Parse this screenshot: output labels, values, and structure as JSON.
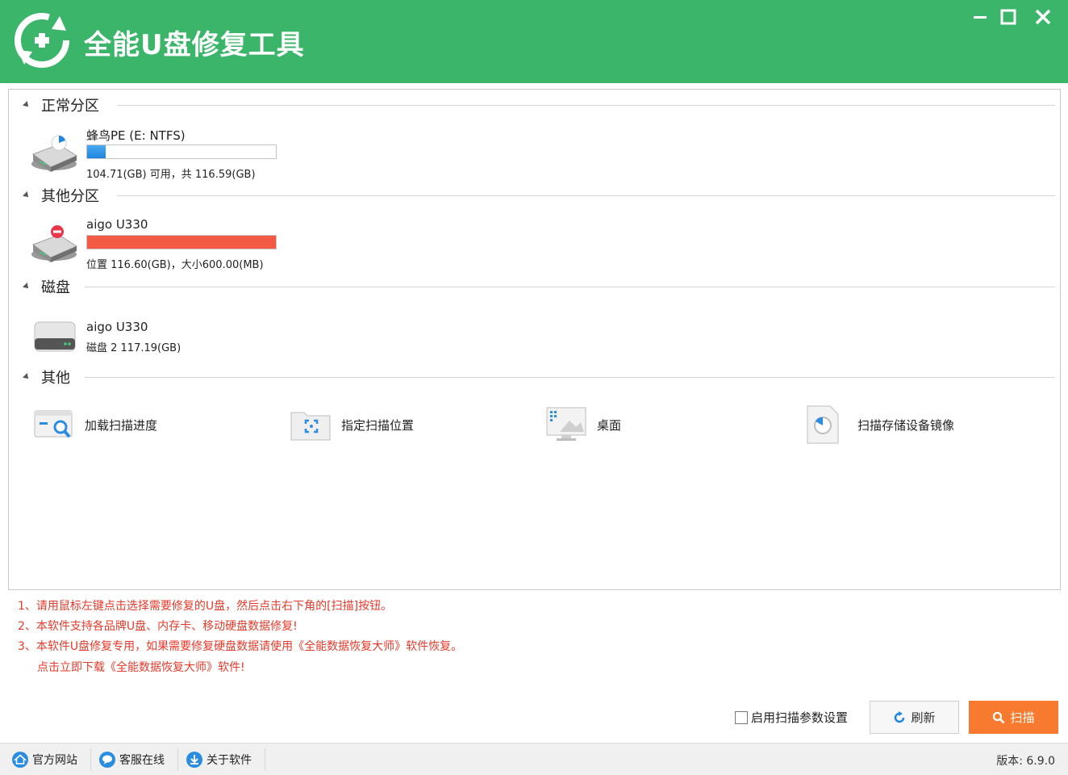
{
  "window": {
    "title": "全能U盘修复工具",
    "minimize_icon": "minimize-icon",
    "maximize_icon": "maximize-icon",
    "close_icon": "close-icon"
  },
  "colors": {
    "titlebar": "#3bb56a",
    "accent_orange": "#f77a2e",
    "note_red": "#e53a2b",
    "usage_blue": "#1f86e0",
    "usage_red": "#f25a44"
  },
  "sections": {
    "normal": {
      "title": "正常分区",
      "drive": {
        "name": "蜂鸟PE (E: NTFS)",
        "usage_fraction": 0.1,
        "info": "104.71(GB) 可用，共 116.59(GB)"
      }
    },
    "other_partition": {
      "title": "其他分区",
      "drive": {
        "name": "aigo U330",
        "usage_fraction": 1.0,
        "info": "位置 116.60(GB)，大小600.00(MB)"
      }
    },
    "disk": {
      "title": "磁盘",
      "drive": {
        "name": "aigo U330",
        "info": "磁盘 2     117.19(GB)"
      }
    },
    "others": {
      "title": "其他",
      "items": [
        {
          "label": "加载扫描进度",
          "icon": "load-scan-progress-icon"
        },
        {
          "label": "指定扫描位置",
          "icon": "folder-target-icon"
        },
        {
          "label": "桌面",
          "icon": "desktop-icon"
        },
        {
          "label": "扫描存储设备镜像",
          "icon": "image-file-icon"
        }
      ]
    }
  },
  "notes": [
    "1、请用鼠标左键点击选择需要修复的U盘，然后点击右下角的[扫描]按钮。",
    "2、本软件支持各品牌U盘、内存卡、移动硬盘数据修复!",
    "3、本软件U盘修复专用，如果需要修复硬盘数据请使用《全能数据恢复大师》软件恢复。",
    "点击立即下载《全能数据恢复大师》软件!"
  ],
  "controls": {
    "checkbox_label": "启用扫描参数设置",
    "checkbox_checked": false,
    "refresh_label": "刷新",
    "scan_label": "扫描"
  },
  "statusbar": {
    "links": [
      "官方网站",
      "客服在线",
      "关于软件"
    ],
    "version": "版本: 6.9.0"
  }
}
